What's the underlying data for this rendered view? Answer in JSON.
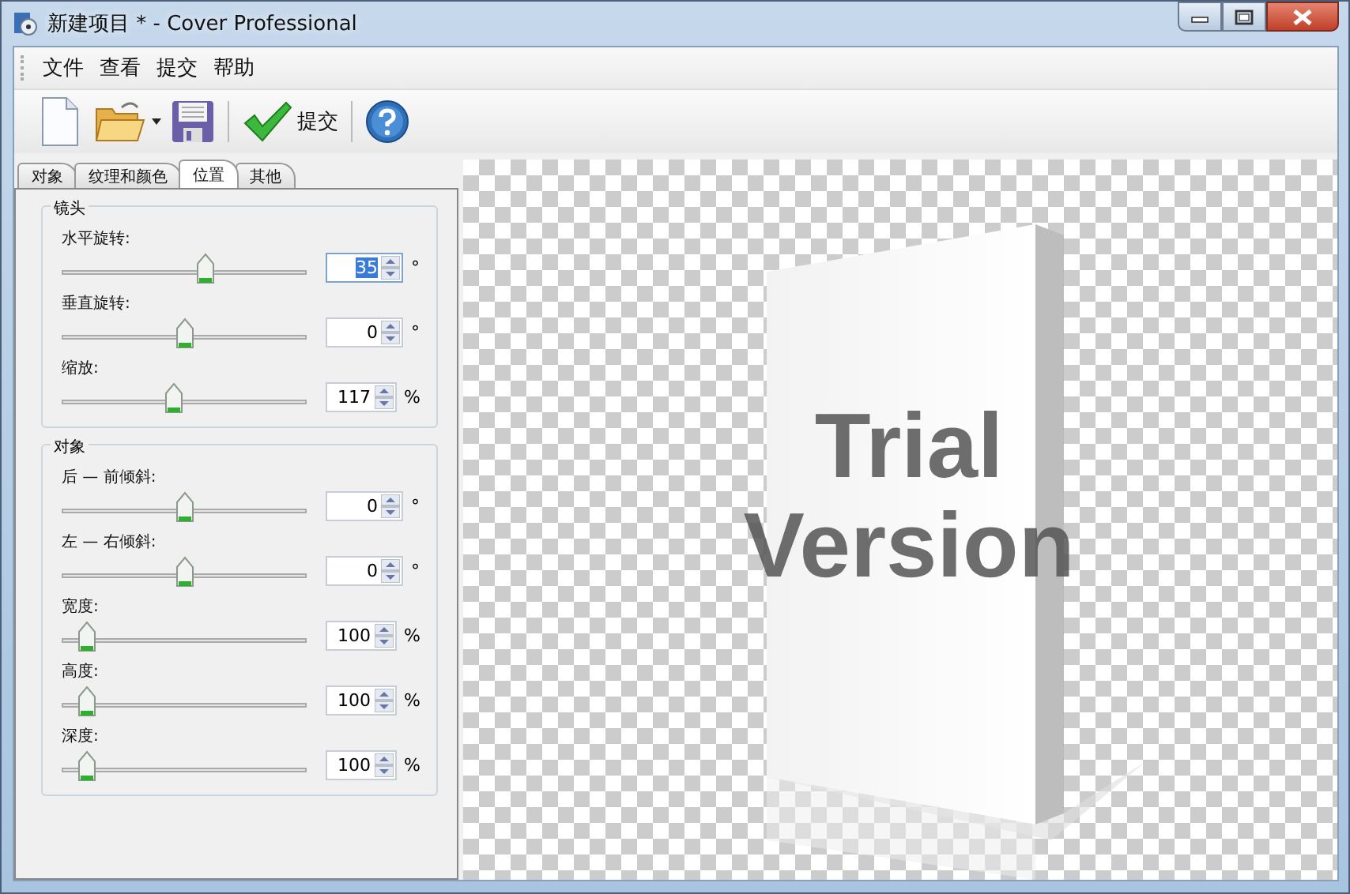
{
  "window": {
    "title": "新建项目 * - Cover Professional"
  },
  "menu": [
    "文件",
    "查看",
    "提交",
    "帮助"
  ],
  "toolbar": {
    "submit_label": "提交"
  },
  "tabs": [
    {
      "label": "对象",
      "selected": false
    },
    {
      "label": "纹理和颜色",
      "selected": false
    },
    {
      "label": "位置",
      "selected": true
    },
    {
      "label": "其他",
      "selected": false
    }
  ],
  "groups": [
    {
      "title": "镜头",
      "sliders": [
        {
          "label": "水平旋转:",
          "level": 0.59,
          "value": "35",
          "unit": "°",
          "focused": true
        },
        {
          "label": "垂直旋转:",
          "level": 0.5,
          "value": "0",
          "unit": "°",
          "focused": false
        },
        {
          "label": "缩放:",
          "level": 0.46,
          "value": "117",
          "unit": "%",
          "focused": false
        }
      ]
    },
    {
      "title": "对象",
      "sliders": [
        {
          "label": "后 — 前倾斜:",
          "level": 0.5,
          "value": "0",
          "unit": "°",
          "focused": false
        },
        {
          "label": "左 — 右倾斜:",
          "level": 0.5,
          "value": "0",
          "unit": "°",
          "focused": false
        },
        {
          "label": "宽度:",
          "level": 0.1,
          "value": "100",
          "unit": "%",
          "focused": false
        },
        {
          "label": "高度:",
          "level": 0.1,
          "value": "100",
          "unit": "%",
          "focused": false
        },
        {
          "label": "深度:",
          "level": 0.1,
          "value": "100",
          "unit": "%",
          "focused": false
        }
      ]
    }
  ],
  "preview": {
    "cover_text": [
      "Trial",
      "Version"
    ]
  }
}
